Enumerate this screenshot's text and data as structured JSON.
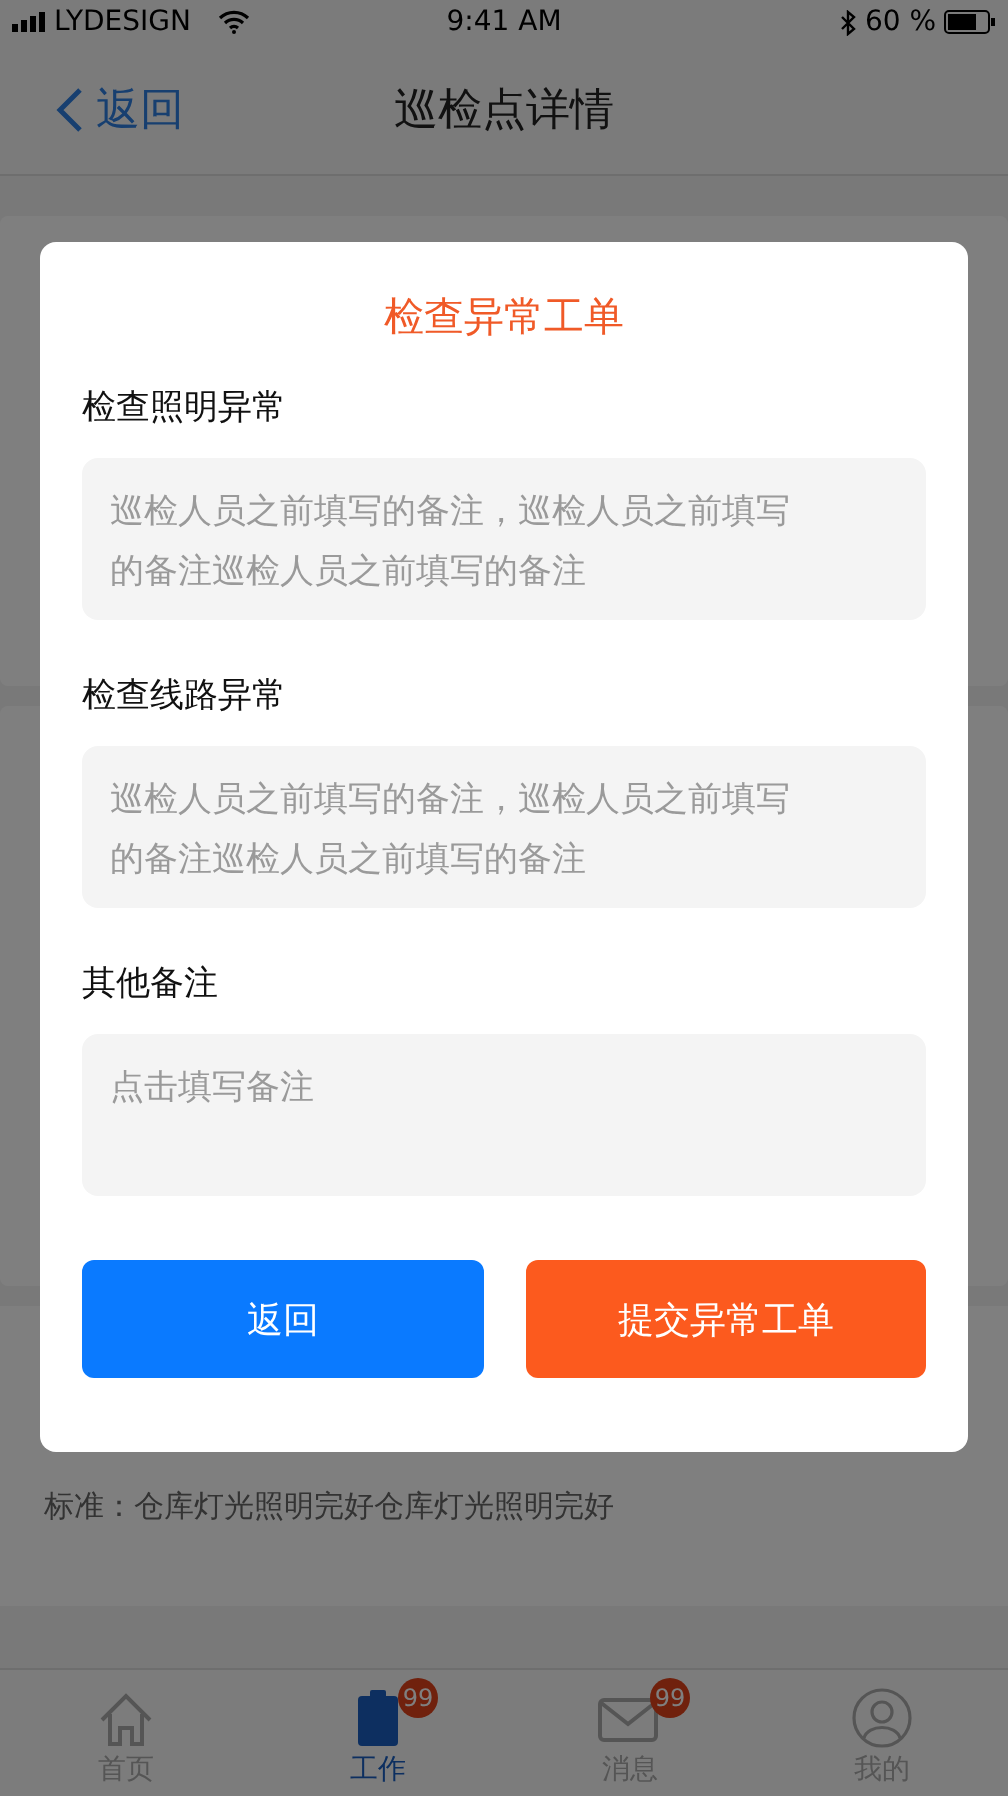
{
  "status_bar": {
    "carrier": "LYDESIGN",
    "time": "9:41 AM",
    "battery": "60 %"
  },
  "nav": {
    "back": "返回",
    "title": "巡检点详情"
  },
  "page": {
    "standard": "标准：仓库灯光照明完好仓库灯光照明完好"
  },
  "dialog": {
    "title": "检查异常工单",
    "fields": [
      {
        "label": "检查照明异常",
        "value": "巡检人员之前填写的备注，巡检人员之前填写的备注巡检人员之前填写的备注"
      },
      {
        "label": "检查线路异常",
        "value": "巡检人员之前填写的备注，巡检人员之前填写的备注巡检人员之前填写的备注"
      },
      {
        "label": "其他备注",
        "placeholder": "点击填写备注"
      }
    ],
    "buttons": [
      {
        "label": "返回",
        "kind": "secondary"
      },
      {
        "label": "提交异常工单",
        "kind": "primary"
      }
    ]
  },
  "tab_bar": [
    {
      "label": "首页",
      "kind": "home",
      "selected": false
    },
    {
      "label": "工作",
      "kind": "clipboard",
      "selected": true,
      "badge": "99"
    },
    {
      "label": "消息",
      "kind": "mail",
      "selected": false,
      "badge": "99"
    },
    {
      "label": "我的",
      "kind": "user",
      "selected": false
    }
  ]
}
